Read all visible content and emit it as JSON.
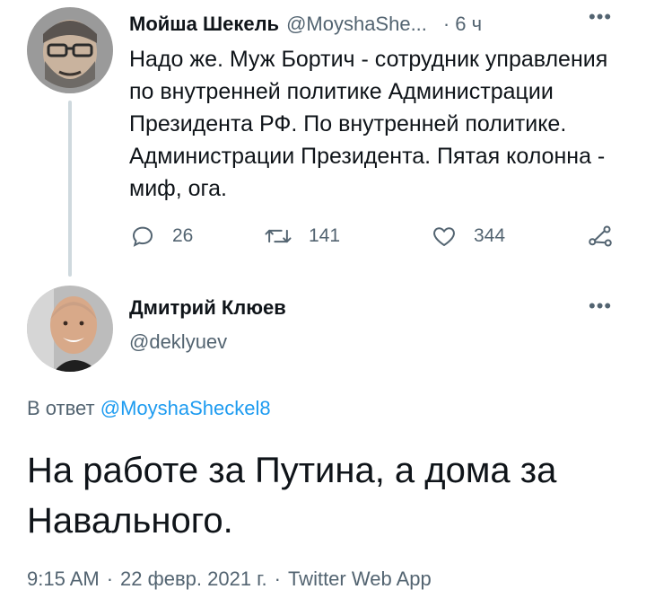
{
  "tweet_parent": {
    "author_name": "Мойша Шекель",
    "author_handle": "@MoyshaShe...",
    "separator": "·",
    "time": "6 ч",
    "text": "Надо же. Муж Бортич - сотрудник управления по внутренней политике Администрации Президента РФ. По внутренней политике. Администрации Президента. Пятая колонна - миф, ога.",
    "replies": "26",
    "retweets": "141",
    "likes": "344",
    "more_icon": "more-horizontal-icon"
  },
  "tweet_main": {
    "author_name": "Дмитрий Клюев",
    "author_handle": "@deklyuev",
    "reply_prefix": "В ответ",
    "reply_mention": "@MoyshaSheckel8",
    "text": "На работе за Путина, а дома за Навального.",
    "time": "9:15 AM",
    "date": "22 февр. 2021 г.",
    "separator": "·",
    "source": "Twitter Web App"
  },
  "colors": {
    "text_primary": "#0f1419",
    "text_secondary": "#536471",
    "link": "#1d9bf0",
    "thread_line": "#cfd9de"
  }
}
